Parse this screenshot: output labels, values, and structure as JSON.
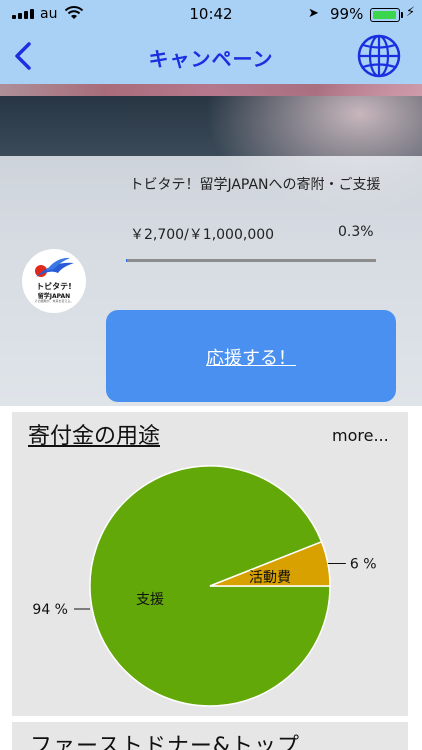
{
  "status_bar": {
    "carrier": "au",
    "time": "10:42",
    "battery_percent": "99%",
    "battery_level": 0.99
  },
  "nav": {
    "title": "キャンペーン",
    "back_icon": "chevron-left-icon",
    "globe_icon": "globe-icon",
    "accent_color": "#1a2fe0",
    "bar_color": "#a9d1f6"
  },
  "campaign": {
    "organization_text": "トビタテ！留学JAPANへの寄附・ご支援",
    "amount_text": "￥2,700/￥1,000,000",
    "percent_text": "0.3%",
    "progress_fraction": 0.003,
    "logo": {
      "line1": "トビタテ!",
      "line2": "留学JAPAN",
      "line3": "その経験が、未来を変える。"
    },
    "cta_label": "応援する！",
    "cta_color": "#4a90f0"
  },
  "usage": {
    "heading": "寄付金の用途",
    "more_label": "more...",
    "chart_data": {
      "type": "pie",
      "labels": [
        "支援",
        "活動費"
      ],
      "values": [
        94,
        6
      ],
      "value_labels": [
        "94 %",
        "6 %"
      ],
      "colors": [
        "#62a808",
        "#d8a100"
      ]
    }
  },
  "next_section": {
    "heading": "ファーストドナー&トップ"
  }
}
